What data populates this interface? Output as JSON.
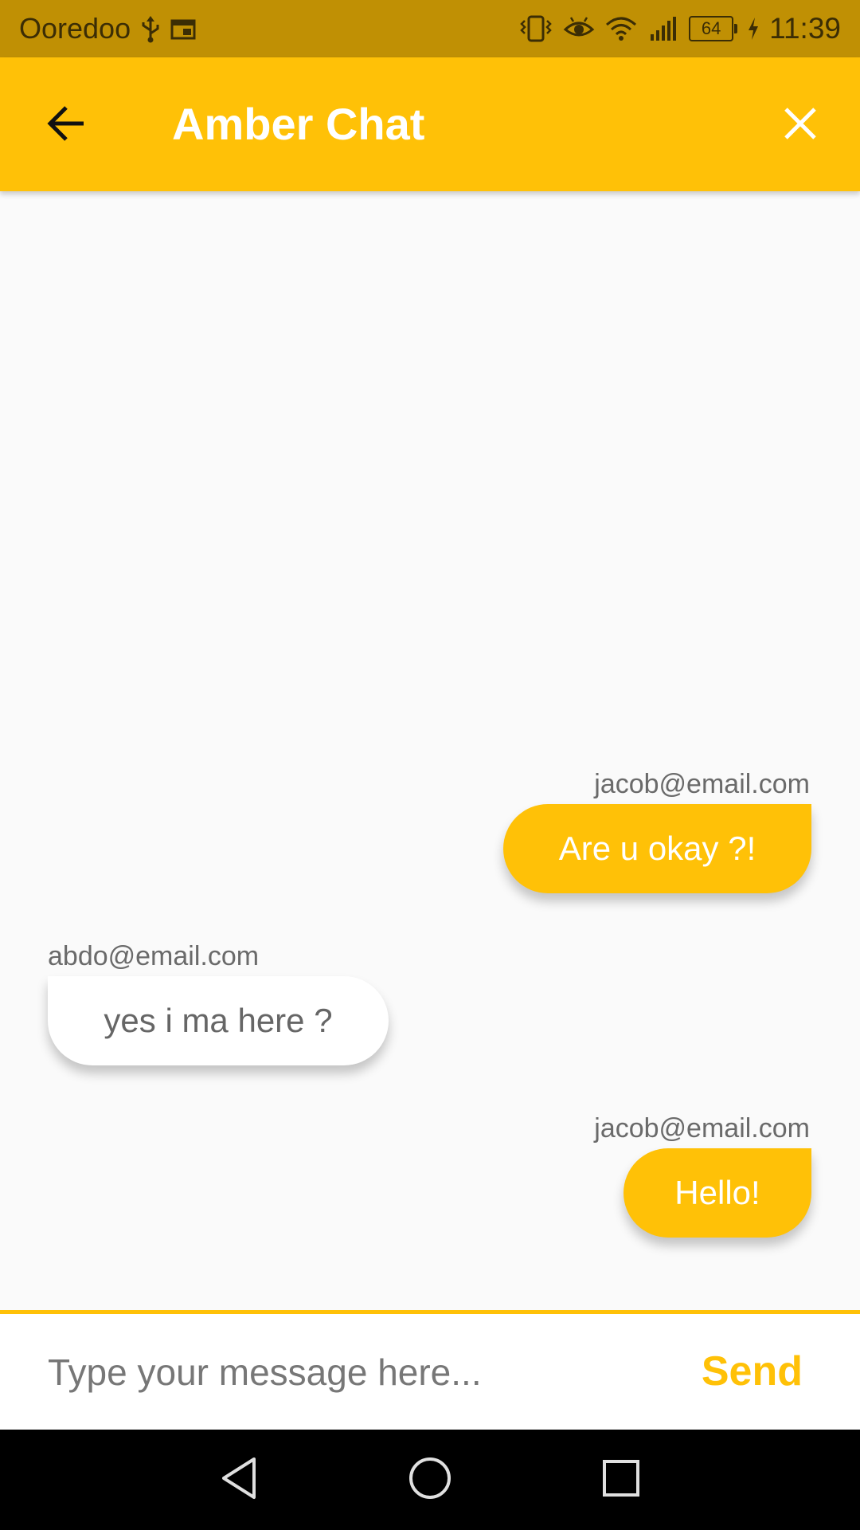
{
  "status_bar": {
    "carrier": "Ooredoo",
    "battery_level": "64",
    "time": "11:39",
    "icons": [
      "usb-icon",
      "calendar-icon",
      "vibrate-icon",
      "eye-icon",
      "wifi-icon",
      "signal-icon",
      "battery-icon",
      "charging-icon"
    ]
  },
  "app_bar": {
    "title": "Amber Chat",
    "back_icon": "arrow-back-icon",
    "close_icon": "close-icon"
  },
  "messages": [
    {
      "sender": "jacob@email.com",
      "text": "Are u okay ?!",
      "is_me": true
    },
    {
      "sender": "abdo@email.com",
      "text": "yes i ma here ?",
      "is_me": false
    },
    {
      "sender": "jacob@email.com",
      "text": "Hello!",
      "is_me": true
    }
  ],
  "input": {
    "value": "",
    "placeholder": "Type your message here...",
    "send_label": "Send"
  },
  "nav_bar": {
    "icons": [
      "nav-back-icon",
      "nav-home-icon",
      "nav-recents-icon"
    ]
  },
  "colors": {
    "accent": "#ffc107",
    "status_bar": "#c09004",
    "background": "#fafafa"
  }
}
